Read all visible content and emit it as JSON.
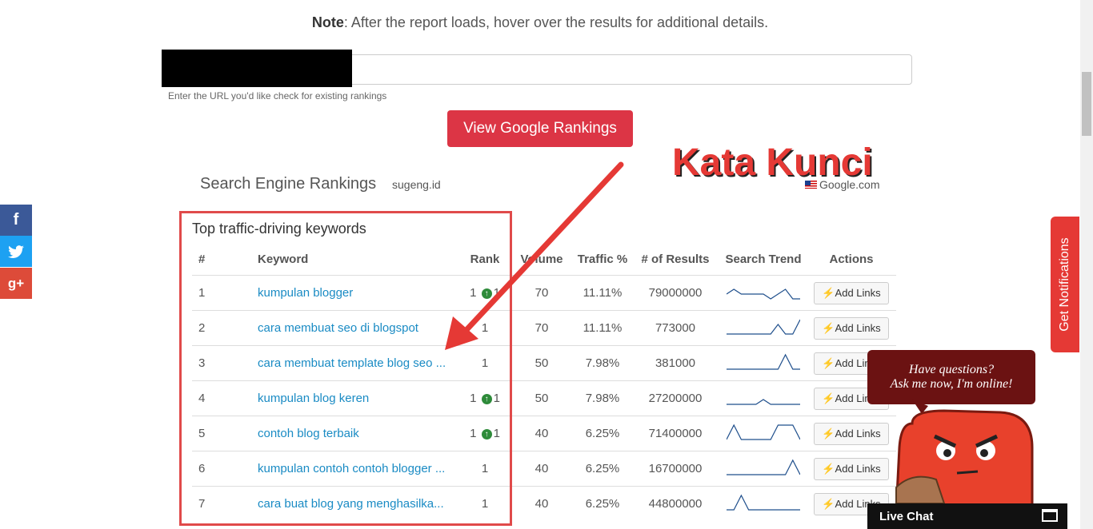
{
  "note": {
    "bold": "Note",
    "text": ": After the report loads, hover over the results for additional details."
  },
  "url_help": "Enter the URL you'd like check for existing rankings",
  "view_button": "View Google Rankings",
  "rankings": {
    "title": "Search Engine Rankings",
    "domain": "sugeng.id",
    "engine": "Google.com"
  },
  "annotation": "Kata Kunci",
  "keywords": {
    "title": "Top traffic-driving keywords",
    "headers": [
      "#",
      "Keyword",
      "Rank",
      "Volume",
      "Traffic %",
      "# of Results",
      "Search Trend",
      "Actions"
    ],
    "rows": [
      {
        "num": "1",
        "keyword": "kumpulan blogger",
        "rank": "1",
        "rank_change": "1",
        "volume": "70",
        "traffic": "11.11%",
        "results": "79000000",
        "action": "Add Links",
        "trend": [
          2,
          1,
          2,
          2,
          2,
          2,
          3,
          2,
          1,
          3,
          3
        ]
      },
      {
        "num": "2",
        "keyword": "cara membuat seo di blogspot",
        "rank": "1",
        "rank_change": "",
        "volume": "70",
        "traffic": "11.11%",
        "results": "773000",
        "action": "Add Links",
        "trend": [
          3,
          3,
          3,
          3,
          3,
          3,
          3,
          1,
          3,
          3,
          0
        ]
      },
      {
        "num": "3",
        "keyword": "cara membuat template blog seo ...",
        "rank": "1",
        "rank_change": "",
        "volume": "50",
        "traffic": "7.98%",
        "results": "381000",
        "action": "Add Links",
        "trend": [
          3,
          3,
          3,
          3,
          3,
          3,
          3,
          3,
          0,
          3,
          3
        ]
      },
      {
        "num": "4",
        "keyword": "kumpulan blog keren",
        "rank": "1",
        "rank_change": "1",
        "volume": "50",
        "traffic": "7.98%",
        "results": "27200000",
        "action": "Add Links",
        "trend": [
          3,
          3,
          3,
          3,
          3,
          2,
          3,
          3,
          3,
          3,
          3
        ]
      },
      {
        "num": "5",
        "keyword": "contoh blog terbaik",
        "rank": "1",
        "rank_change": "1",
        "volume": "40",
        "traffic": "6.25%",
        "results": "71400000",
        "action": "Add Links",
        "trend": [
          3,
          0,
          3,
          3,
          3,
          3,
          3,
          0,
          0,
          0,
          3
        ]
      },
      {
        "num": "6",
        "keyword": "kumpulan contoh contoh blogger ...",
        "rank": "1",
        "rank_change": "",
        "volume": "40",
        "traffic": "6.25%",
        "results": "16700000",
        "action": "Add Links",
        "trend": [
          3,
          3,
          3,
          3,
          3,
          3,
          3,
          3,
          3,
          0,
          3
        ]
      },
      {
        "num": "7",
        "keyword": "cara buat blog yang menghasilka...",
        "rank": "1",
        "rank_change": "",
        "volume": "40",
        "traffic": "6.25%",
        "results": "44800000",
        "action": "Add Links",
        "trend": [
          3,
          3,
          0,
          3,
          3,
          3,
          3,
          3,
          3,
          3,
          3
        ]
      }
    ]
  },
  "social": {
    "facebook": "f",
    "twitter": "t",
    "gplus": "g+"
  },
  "notifications": "Get Notifications",
  "chat": {
    "bubble_line1": "Have questions?",
    "bubble_line2": "Ask me now, I'm online!",
    "label": "Live Chat"
  },
  "colors": {
    "primary": "#dc3545",
    "link": "#1a8bc4",
    "annotation": "#e53935"
  }
}
